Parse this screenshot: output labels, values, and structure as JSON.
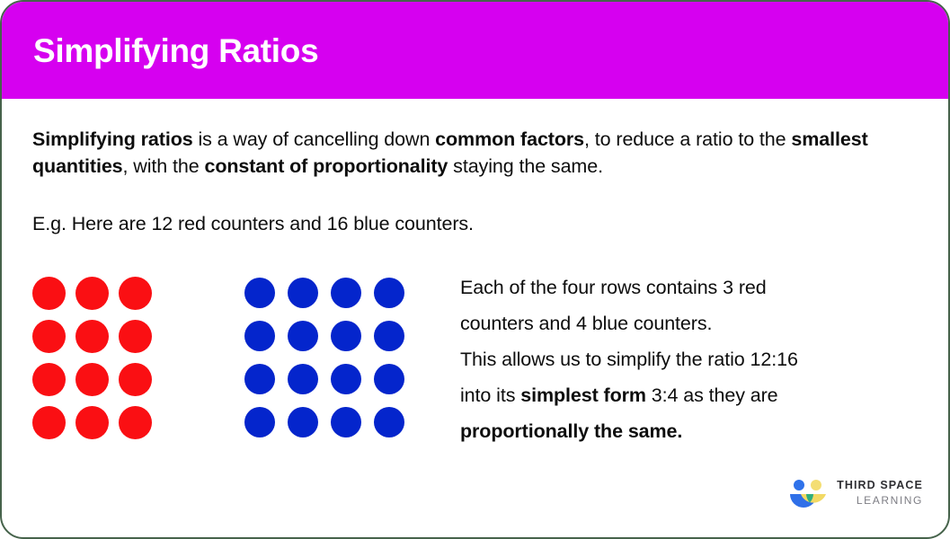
{
  "card": {
    "border_color": "#46634b",
    "background": "#ffffff"
  },
  "header": {
    "title": "Simplifying Ratios",
    "background_color": "#d600f0",
    "text_color": "#ffffff"
  },
  "intro": {
    "part1_bold": "Simplifying ratios",
    "part2": " is a way of cancelling down ",
    "part3_bold": "common factors",
    "part4": ", to reduce a ratio to the ",
    "part5_bold": "smallest quantities",
    "part6": ", with the ",
    "part7_bold": "constant of proportionality",
    "part8": " staying the same."
  },
  "example": {
    "text": "E.g. Here are 12 red counters and 16 blue counters."
  },
  "counters": {
    "red": {
      "color": "#fa0f13",
      "rows": 4,
      "columns": 3,
      "total": 12,
      "label": "red counters"
    },
    "blue": {
      "color": "#0425cc",
      "rows": 4,
      "columns": 4,
      "total": 16,
      "label": "blue counters"
    }
  },
  "explanation": {
    "line1": "Each of the four rows contains 3 red",
    "line2": "counters and 4 blue counters.",
    "line3": "This allows us to simplify the ratio 12:16",
    "line4_pre": "into its ",
    "line4_bold": "simplest form",
    "line4_post": " 3:4 as they are",
    "line5_bold": "proportionally the same."
  },
  "logo": {
    "name_top": "THIRD SPACE",
    "name_bottom": "LEARNING",
    "blue": "#2f6fe8",
    "blue_head": "#2f72ea",
    "yellow": "#f2d964",
    "yellow_head": "#f4de74",
    "green": "#2fae7e"
  }
}
